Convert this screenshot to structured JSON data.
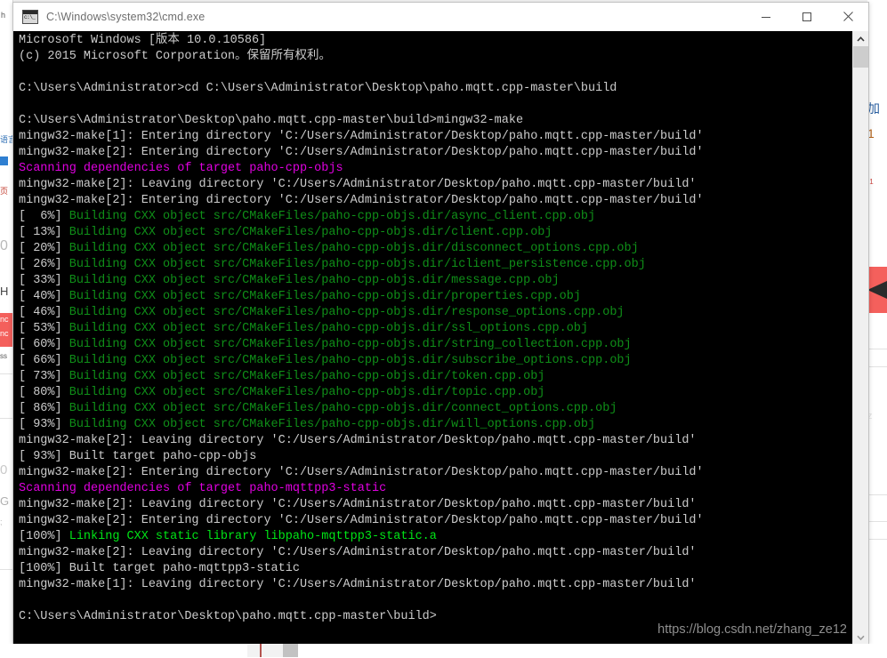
{
  "window": {
    "title": "C:\\Windows\\system32\\cmd.exe",
    "icon": "cmd-console-icon",
    "minimize_label": "Minimize",
    "maximize_label": "Maximize",
    "close_label": "Close"
  },
  "colors": {
    "console_bg": "#000000",
    "text_white": "#cccccc",
    "text_green": "#0f8f18",
    "text_bright_green": "#00e516",
    "text_magenta": "#e000e0",
    "titlebar_bg": "#ffffff",
    "title_text": "#6e6e6e",
    "watermark": "#8e8e8e"
  },
  "console": {
    "lines": [
      {
        "text": "Microsoft Windows [版本 10.0.10586]",
        "color": "white"
      },
      {
        "text": "(c) 2015 Microsoft Corporation。保留所有权利。",
        "color": "white"
      },
      {
        "text": "",
        "color": "white"
      },
      {
        "text": "C:\\Users\\Administrator>cd C:\\Users\\Administrator\\Desktop\\paho.mqtt.cpp-master\\build",
        "color": "white"
      },
      {
        "text": "",
        "color": "white"
      },
      {
        "text": "C:\\Users\\Administrator\\Desktop\\paho.mqtt.cpp-master\\build>mingw32-make",
        "color": "white"
      },
      {
        "text": "mingw32-make[1]: Entering directory 'C:/Users/Administrator/Desktop/paho.mqtt.cpp-master/build'",
        "color": "white"
      },
      {
        "text": "mingw32-make[2]: Entering directory 'C:/Users/Administrator/Desktop/paho.mqtt.cpp-master/build'",
        "color": "white"
      },
      {
        "text": "Scanning dependencies of target paho-cpp-objs",
        "color": "magenta"
      },
      {
        "text": "mingw32-make[2]: Leaving directory 'C:/Users/Administrator/Desktop/paho.mqtt.cpp-master/build'",
        "color": "white"
      },
      {
        "text": "mingw32-make[2]: Entering directory 'C:/Users/Administrator/Desktop/paho.mqtt.cpp-master/build'",
        "color": "white"
      },
      {
        "prefix": "[  6%] ",
        "text": "Building CXX object src/CMakeFiles/paho-cpp-objs.dir/async_client.cpp.obj",
        "color": "green"
      },
      {
        "prefix": "[ 13%] ",
        "text": "Building CXX object src/CMakeFiles/paho-cpp-objs.dir/client.cpp.obj",
        "color": "green"
      },
      {
        "prefix": "[ 20%] ",
        "text": "Building CXX object src/CMakeFiles/paho-cpp-objs.dir/disconnect_options.cpp.obj",
        "color": "green"
      },
      {
        "prefix": "[ 26%] ",
        "text": "Building CXX object src/CMakeFiles/paho-cpp-objs.dir/iclient_persistence.cpp.obj",
        "color": "green"
      },
      {
        "prefix": "[ 33%] ",
        "text": "Building CXX object src/CMakeFiles/paho-cpp-objs.dir/message.cpp.obj",
        "color": "green"
      },
      {
        "prefix": "[ 40%] ",
        "text": "Building CXX object src/CMakeFiles/paho-cpp-objs.dir/properties.cpp.obj",
        "color": "green"
      },
      {
        "prefix": "[ 46%] ",
        "text": "Building CXX object src/CMakeFiles/paho-cpp-objs.dir/response_options.cpp.obj",
        "color": "green"
      },
      {
        "prefix": "[ 53%] ",
        "text": "Building CXX object src/CMakeFiles/paho-cpp-objs.dir/ssl_options.cpp.obj",
        "color": "green"
      },
      {
        "prefix": "[ 60%] ",
        "text": "Building CXX object src/CMakeFiles/paho-cpp-objs.dir/string_collection.cpp.obj",
        "color": "green"
      },
      {
        "prefix": "[ 66%] ",
        "text": "Building CXX object src/CMakeFiles/paho-cpp-objs.dir/subscribe_options.cpp.obj",
        "color": "green"
      },
      {
        "prefix": "[ 73%] ",
        "text": "Building CXX object src/CMakeFiles/paho-cpp-objs.dir/token.cpp.obj",
        "color": "green"
      },
      {
        "prefix": "[ 80%] ",
        "text": "Building CXX object src/CMakeFiles/paho-cpp-objs.dir/topic.cpp.obj",
        "color": "green"
      },
      {
        "prefix": "[ 86%] ",
        "text": "Building CXX object src/CMakeFiles/paho-cpp-objs.dir/connect_options.cpp.obj",
        "color": "green"
      },
      {
        "prefix": "[ 93%] ",
        "text": "Building CXX object src/CMakeFiles/paho-cpp-objs.dir/will_options.cpp.obj",
        "color": "green"
      },
      {
        "text": "mingw32-make[2]: Leaving directory 'C:/Users/Administrator/Desktop/paho.mqtt.cpp-master/build'",
        "color": "white"
      },
      {
        "text": "[ 93%] Built target paho-cpp-objs",
        "color": "white"
      },
      {
        "text": "mingw32-make[2]: Entering directory 'C:/Users/Administrator/Desktop/paho.mqtt.cpp-master/build'",
        "color": "white"
      },
      {
        "text": "Scanning dependencies of target paho-mqttpp3-static",
        "color": "magenta"
      },
      {
        "text": "mingw32-make[2]: Leaving directory 'C:/Users/Administrator/Desktop/paho.mqtt.cpp-master/build'",
        "color": "white"
      },
      {
        "text": "mingw32-make[2]: Entering directory 'C:/Users/Administrator/Desktop/paho.mqtt.cpp-master/build'",
        "color": "white"
      },
      {
        "prefix": "[100%] ",
        "text": "Linking CXX static library libpaho-mqttpp3-static.a",
        "color": "bgreen"
      },
      {
        "text": "mingw32-make[2]: Leaving directory 'C:/Users/Administrator/Desktop/paho.mqtt.cpp-master/build'",
        "color": "white"
      },
      {
        "text": "[100%] Built target paho-mqttpp3-static",
        "color": "white"
      },
      {
        "text": "mingw32-make[1]: Leaving directory 'C:/Users/Administrator/Desktop/paho.mqtt.cpp-master/build'",
        "color": "white"
      },
      {
        "text": "",
        "color": "white"
      },
      {
        "text": "C:\\Users\\Administrator\\Desktop\\paho.mqtt.cpp-master\\build>",
        "color": "white"
      }
    ]
  },
  "scrollbar": {
    "up_arrow": "chevron-up-icon",
    "down_arrow": "chevron-down-icon"
  },
  "watermark": {
    "text": "https://blog.csdn.net/zhang_ze12"
  },
  "background": {
    "left_fragments": [
      "h",
      "语言",
      "页",
      "nc",
      "nc",
      "ss"
    ],
    "right_fragments": [
      "加",
      "1",
      ":1"
    ]
  }
}
